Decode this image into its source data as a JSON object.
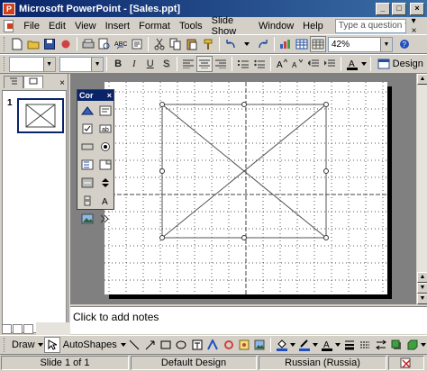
{
  "window": {
    "title": "Microsoft PowerPoint - [Sales.ppt]",
    "app_icon": "P"
  },
  "window_buttons": {
    "minimize": "_",
    "maximize": "□",
    "close": "×"
  },
  "menu": {
    "items": [
      "File",
      "Edit",
      "View",
      "Insert",
      "Format",
      "Tools",
      "Slide Show",
      "Window",
      "Help"
    ],
    "help_placeholder": "Type a question for help",
    "mdi_controls": "▾ ×"
  },
  "standard_toolbar": {
    "zoom": "42%"
  },
  "formatting_toolbar": {
    "bold": "B",
    "italic": "I",
    "underline": "U",
    "shadow": "S",
    "font_color_glyph": "A",
    "design_label": "Design"
  },
  "panel": {
    "slide_number": "1",
    "close": "×"
  },
  "floating_toolbar": {
    "title": "Cor",
    "close": "×"
  },
  "notes": {
    "placeholder": "Click to add notes"
  },
  "draw_toolbar": {
    "draw_label": "Draw",
    "autoshapes_label": "AutoShapes"
  },
  "status": {
    "slide": "Slide 1 of 1",
    "design": "Default Design",
    "language": "Russian (Russia)"
  },
  "colors": {
    "title_start": "#0a246a",
    "title_end": "#3a6ea5",
    "chrome": "#d4d0c8",
    "workspace": "#808080"
  }
}
